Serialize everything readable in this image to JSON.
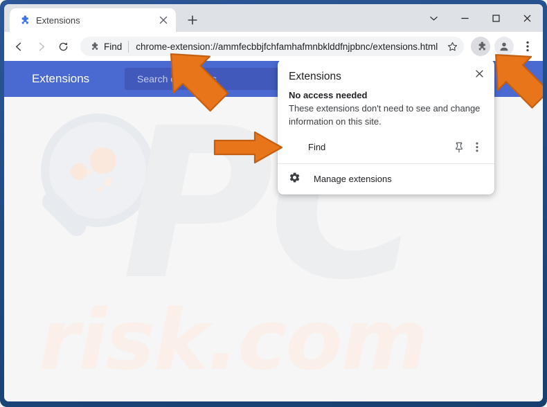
{
  "window": {
    "controls": [
      {
        "name": "chevron-down",
        "glyph": "⌄"
      },
      {
        "name": "minimize",
        "glyph": "—"
      },
      {
        "name": "maximize",
        "glyph": "□"
      },
      {
        "name": "close",
        "glyph": "✕"
      }
    ]
  },
  "tab": {
    "title": "Extensions",
    "favicon": "puzzle-piece-icon",
    "close_label": "✕",
    "newtab_label": "+"
  },
  "toolbar": {
    "back_label": "←",
    "forward_label": "→",
    "reload_label": "⟳",
    "omnibox": {
      "extension_chip_label": "Find",
      "url": "chrome-extension://ammfecbbjfchfamhafmnbklddfnjpbnc/extensions.html",
      "star_label": "☆"
    },
    "extensions_icon": "puzzle-piece-icon",
    "profile_icon": "avatar-icon",
    "menu_label": "⋮"
  },
  "page": {
    "header_title": "Extensions",
    "search_placeholder": "Search extensions",
    "header_color": "#4a69d1",
    "watermark_pc": "PC",
    "watermark_risk": "risk.com"
  },
  "popup": {
    "title": "Extensions",
    "close_label": "✕",
    "section_heading": "No access needed",
    "section_description": "These extensions don't need to see and change information on this site.",
    "extensions": [
      {
        "name": "Find",
        "pin_icon": "pin-icon",
        "menu_icon": "more-vertical-icon"
      }
    ],
    "footer": {
      "icon": "gear-icon",
      "label": "Manage extensions"
    }
  },
  "annotations": {
    "accent_color": "#e8751a",
    "arrows": [
      {
        "name": "arrow-to-omnibox",
        "direction": "up-left"
      },
      {
        "name": "arrow-to-extensions-icon",
        "direction": "up-left"
      },
      {
        "name": "arrow-to-find-extension",
        "direction": "right"
      }
    ]
  }
}
